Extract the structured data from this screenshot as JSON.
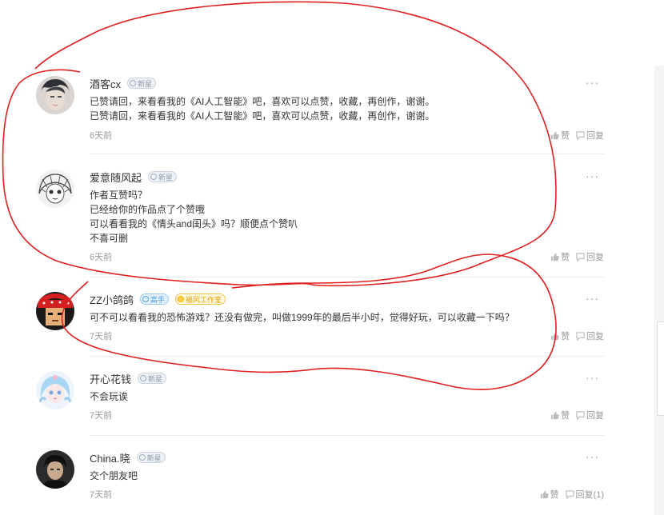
{
  "comments": [
    {
      "name": "酒客cx",
      "badge": "新星",
      "lines": [
        "已赞请回，来看看我的《AI人工智能》吧，喜欢可以点赞，收藏，再创作，谢谢。",
        "已赞请回，来看看我的《AI人工智能》吧，喜欢可以点赞，收藏，再创作，谢谢。"
      ],
      "time": "6天前",
      "like": "赞",
      "reply": "回复"
    },
    {
      "name": "爱意随风起",
      "badge": "新星",
      "lines": [
        "作者互赞吗？",
        "已经给你的作品点了个赞哦",
        "可以看看我的《情头and闺头》吗？顺便点个赞叭",
        "不喜可删"
      ],
      "time": "6天前",
      "like": "赞",
      "reply": "回复"
    },
    {
      "name": "ZZ小鸽鸽",
      "badge": "高手",
      "badge2": "福风工作室",
      "lines": [
        "可不可以看看我的恐怖游戏？还没有做完，叫做1999年的最后半小时，觉得好玩，可以收藏一下吗？"
      ],
      "time": "7天前",
      "like": "赞",
      "reply": "回复"
    },
    {
      "name": "开心花钱",
      "badge": "新星",
      "lines": [
        "不会玩诶"
      ],
      "time": "7天前",
      "like": "赞",
      "reply": "回复"
    },
    {
      "name": "China.晓",
      "badge": "新星",
      "lines": [
        "交个朋友吧"
      ],
      "time": "7天前",
      "like": "赞",
      "reply": "回复(1)"
    }
  ],
  "more_label": "···",
  "annotation_color": "#e02020"
}
